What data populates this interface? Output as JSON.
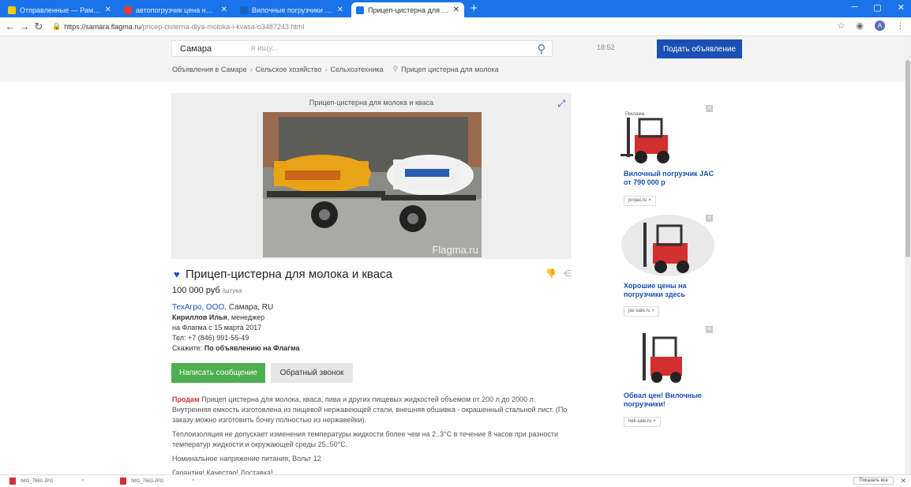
{
  "browser": {
    "tabs": [
      {
        "title": "Отправленные — Рамблер/поч…",
        "favicon_color": "#ffcc00",
        "active": false
      },
      {
        "title": "автопогрузчик цена нового — …",
        "favicon_color": "#e53935",
        "active": false
      },
      {
        "title": "Вилочные погрузчики купить в …",
        "favicon_color": "#1565c0",
        "active": false
      },
      {
        "title": "Прицеп-цистерна для молока и …",
        "favicon_color": "#1a73e8",
        "active": true
      }
    ],
    "new_tab": "+",
    "url_host": "https://samara.flagma.ru",
    "url_path": "/pricep-cisterna-dlya-moloka-i-kvasa-o3487243.html"
  },
  "header": {
    "city": "Самара",
    "search_placeholder": "я ищу...",
    "time": "18:52",
    "post_button": "Подать объявление",
    "breadcrumbs": [
      "Объявления в Самаре",
      "Сельское хозяйство",
      "Сельхозтехника",
      "Прицеп цистерна для молока"
    ]
  },
  "listing": {
    "gallery_title": "Прицеп-цистерна для молока и кваса",
    "watermark": "Flagma.ru",
    "title": "Прицеп-цистерна для молока и кваса",
    "price": "100 000 руб",
    "price_unit": "/штука",
    "company": "ТехАгро, ООО",
    "location": "Самара, RU",
    "contact_name": "Кириллов Илья",
    "contact_role": ", менеджер",
    "member_since": "на Флагма с 15 марта 2017",
    "phone": "Тел: +7 (846) 991-55-49",
    "say_prefix": "Скажите: ",
    "say_text": "По объявлению на Флагма",
    "message_button": "Написать сообщение",
    "callback_button": "Обратный звонок",
    "desc_sell": "Продам",
    "desc_1": " Прицеп цистерна для молока, кваса, пива и других пищевых жидкостей объемом от 200 л до 2000 л. Внутренняя емкость изготовлена из пищевой нержавеющей стали, внешняя обшивка - окрашенный стальной лист. (По заказу можно изготовить бочку полностью из нержавейки).",
    "desc_2": "Теплоизоляция не допускает изменения температуры жидкости более чем на 2..3°С в течение 8 часов при разности температур жидкости и окружающей среды 25..50°С.",
    "desc_3": "Номинальное напряжение питания, Вольт 12",
    "desc_4": "Гарантия! Качество! Доставка!"
  },
  "ads": {
    "label": "Реклама",
    "items": [
      {
        "title": "Вилочный погрузчик JAC от 790 000 р",
        "link": "projac.ru >"
      },
      {
        "title": "Хорошие цены на погрузчики здесь",
        "link": "jac-sale.ru >"
      },
      {
        "title": "Обвал цен! Вилочные погрузчики!",
        "link": "heli-sale.ru >"
      }
    ]
  },
  "downloads": {
    "items": [
      "IMG_7660.JPG",
      "IMG_7663.JPG"
    ],
    "show_all": "Показать все"
  }
}
